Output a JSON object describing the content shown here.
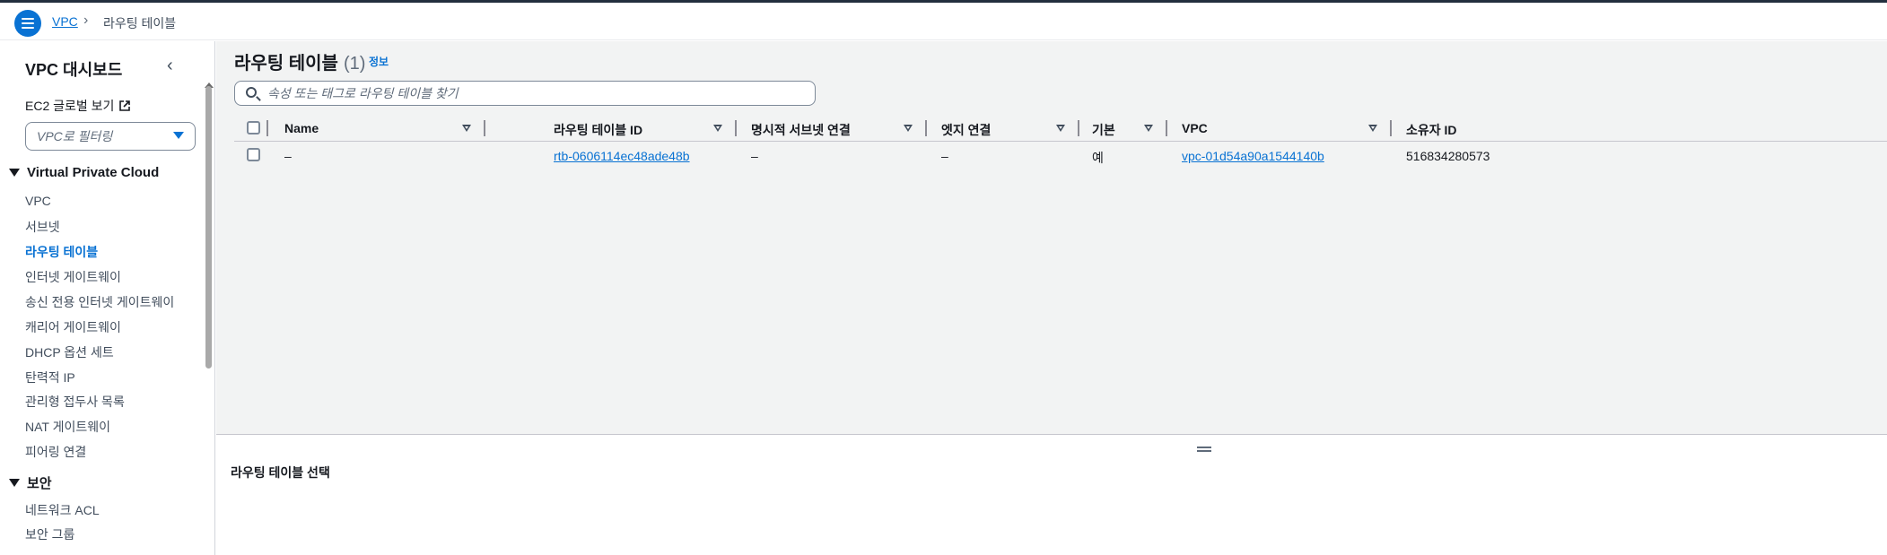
{
  "breadcrumb": {
    "root": "VPC",
    "current": "라우팅 테이블"
  },
  "sidebar": {
    "title": "VPC 대시보드",
    "ec2_global": "EC2 글로벌 보기",
    "filter_placeholder": "VPC로 필터링",
    "sections": [
      {
        "label": "Virtual Private Cloud",
        "items": [
          "VPC",
          "서브넷",
          "라우팅 테이블",
          "인터넷 게이트웨이",
          "송신 전용 인터넷 게이트웨이",
          "캐리어 게이트웨이",
          "DHCP 옵션 세트",
          "탄력적 IP",
          "관리형 접두사 목록",
          "NAT 게이트웨이",
          "피어링 연결"
        ]
      },
      {
        "label": "보안",
        "items": [
          "네트워크 ACL",
          "보안 그룹"
        ]
      }
    ],
    "active_item": "라우팅 테이블"
  },
  "main": {
    "title": "라우팅 테이블",
    "count": "(1)",
    "info": "정보",
    "search_placeholder": "속성 또는 태그로 라우팅 테이블 찾기",
    "columns": [
      "Name",
      "라우팅 테이블 ID",
      "명시적 서브넷 연결",
      "엣지 연결",
      "기본",
      "VPC",
      "소유자 ID"
    ],
    "rows": [
      {
        "name": "–",
        "id": "rtb-0606114ec48ade48b",
        "explicit": "–",
        "edge": "–",
        "main": "예",
        "vpc": "vpc-01d54a90a1544140b",
        "owner": "516834280573"
      }
    ]
  },
  "split_panel": {
    "title": "라우팅 테이블 선택"
  },
  "colors": {
    "accent": "#0972d3",
    "header_dark": "#232f3e",
    "main_bg": "#f2f3f3"
  }
}
